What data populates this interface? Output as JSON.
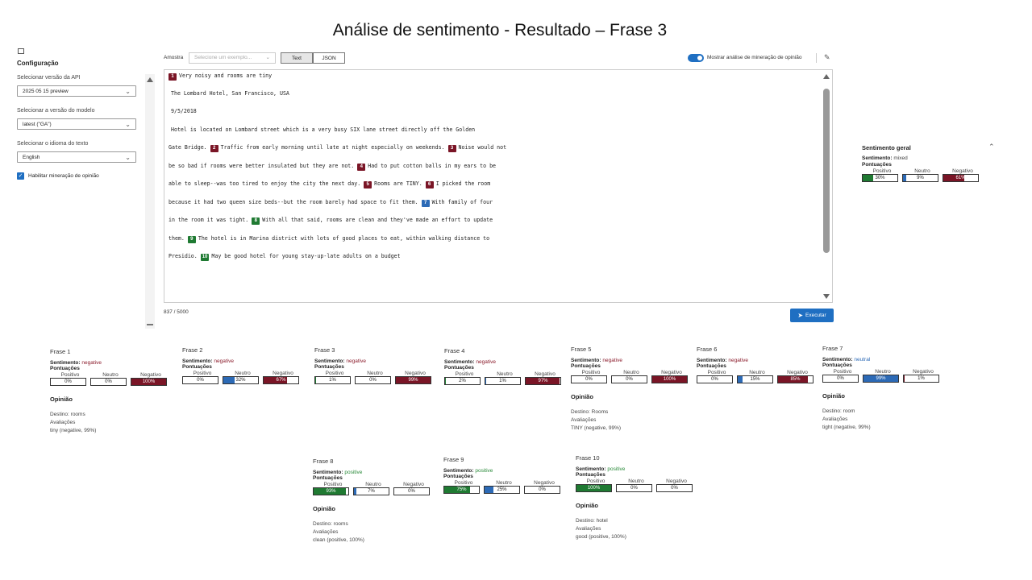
{
  "title": "Análise de sentimento - Resultado – Frase 3",
  "config": {
    "heading": "Configuração",
    "api_label": "Selecionar versão da API",
    "api_value": "2025 05 15 preview",
    "model_label": "Selecionar a versão do modelo",
    "model_value": "latest (\"GA\")",
    "lang_label": "Selecionar o idioma do texto",
    "lang_value": "English",
    "opinion_checkbox": "Habilitar mineração de opinião"
  },
  "toolbar": {
    "sample_label": "Amostra",
    "sample_placeholder": "Selecione um exemplo...",
    "text_tab": "Text",
    "json_tab": "JSON",
    "toggle_label": "Mostrar análise de mineração de opinião"
  },
  "editor": {
    "first_line": "Very noisy and rooms are tiny",
    "lines": [
      "The Lombard Hotel, San Francisco, USA",
      "9/5/2018",
      "Hotel is located on Lombard street which is a very busy SIX lane street directly off the Golden",
      "Gate Bridge.",
      "Traffic from early morning until late at night especially on weekends.",
      "Noise would not",
      "be so bad if rooms were better insulated but they are not.",
      "Had to put cotton balls in my ears to be",
      "able to sleep--was too tired to enjoy the city the next day.",
      "Rooms are TINY.",
      "I picked the room",
      "because it had two queen size beds--but the room barely had space to fit them.",
      "With family of four",
      "in the room it was tight.",
      "With all that said, rooms are clean and they've made an effort to update",
      "them.",
      "The hotel is in Marina district with lots of good places to eat, within walking distance to",
      "Presidio.",
      "May be good hotel for young stay-up-late adults on a budget"
    ],
    "badges": [
      "1",
      "2",
      "3",
      "4",
      "5",
      "6",
      "7",
      "8",
      "9",
      "10"
    ],
    "char_count": "837 / 5000",
    "run_label": "Executar"
  },
  "overall": {
    "title": "Sentimento geral",
    "sentiment_label": "Sentimento:",
    "sentiment_value": "mixed",
    "scores_label": "Pontuações",
    "labels": [
      "Positivo",
      "Neutro",
      "Negativo"
    ],
    "values": [
      30,
      9,
      61
    ],
    "texts": [
      "30%",
      "9%",
      "61%"
    ]
  },
  "common": {
    "sentiment_label": "Sentimento:",
    "scores_label": "Pontuações",
    "labels": [
      "Positivo",
      "Neutro",
      "Negativo"
    ],
    "opinion_label": "Opinião",
    "target_prefix": "Destino:",
    "assessments_label": "Avaliações"
  },
  "sentences": [
    {
      "title": "Frase 1",
      "sentiment": "negative",
      "values": [
        0,
        0,
        100
      ],
      "texts": [
        "0%",
        "0%",
        "100%"
      ],
      "target": "Destino: rooms",
      "assessment": "tiny (negative, 99%)"
    },
    {
      "title": "Frase 2",
      "sentiment": "negative",
      "values": [
        0,
        32,
        67
      ],
      "texts": [
        "0%",
        "32%",
        "67%"
      ]
    },
    {
      "title": "Frase 3",
      "sentiment": "negative",
      "values": [
        1,
        0,
        99
      ],
      "texts": [
        "1%",
        "0%",
        "99%"
      ]
    },
    {
      "title": "Frase 4",
      "sentiment": "negative",
      "values": [
        2,
        1,
        97
      ],
      "texts": [
        "2%",
        "1%",
        "97%"
      ]
    },
    {
      "title": "Frase 5",
      "sentiment": "negative",
      "values": [
        0,
        0,
        100
      ],
      "texts": [
        "0%",
        "0%",
        "100%"
      ],
      "target": "Destino: Rooms",
      "assessment": "TINY (negative, 99%)"
    },
    {
      "title": "Frase 6",
      "sentiment": "negative",
      "values": [
        0,
        15,
        85
      ],
      "texts": [
        "0%",
        "15%",
        "85%"
      ]
    },
    {
      "title": "Frase 7",
      "sentiment": "neutral",
      "values": [
        0,
        99,
        1
      ],
      "texts": [
        "0%",
        "99%",
        "1%"
      ],
      "target": "Destino: room",
      "assessment": "tight (negative, 99%)"
    },
    {
      "title": "Frase 8",
      "sentiment": "positive",
      "values": [
        93,
        7,
        0
      ],
      "texts": [
        "93%",
        "7%",
        "0%"
      ],
      "target": "Destino: rooms",
      "assessment": "clean (positive, 100%)"
    },
    {
      "title": "Frase 9",
      "sentiment": "positive",
      "values": [
        75,
        25,
        0
      ],
      "texts": [
        "75%",
        "25%",
        "0%"
      ]
    },
    {
      "title": "Frase 10",
      "sentiment": "positive",
      "values": [
        100,
        0,
        0
      ],
      "texts": [
        "100%",
        "0%",
        "0%"
      ],
      "target": "Destino: hotel",
      "assessment": "good (positive, 100%)"
    }
  ],
  "colors": {
    "negative": "#7a1526",
    "neutral": "#2c6ab6",
    "positive": "#1f7a32",
    "accent": "#1f6fc2"
  }
}
